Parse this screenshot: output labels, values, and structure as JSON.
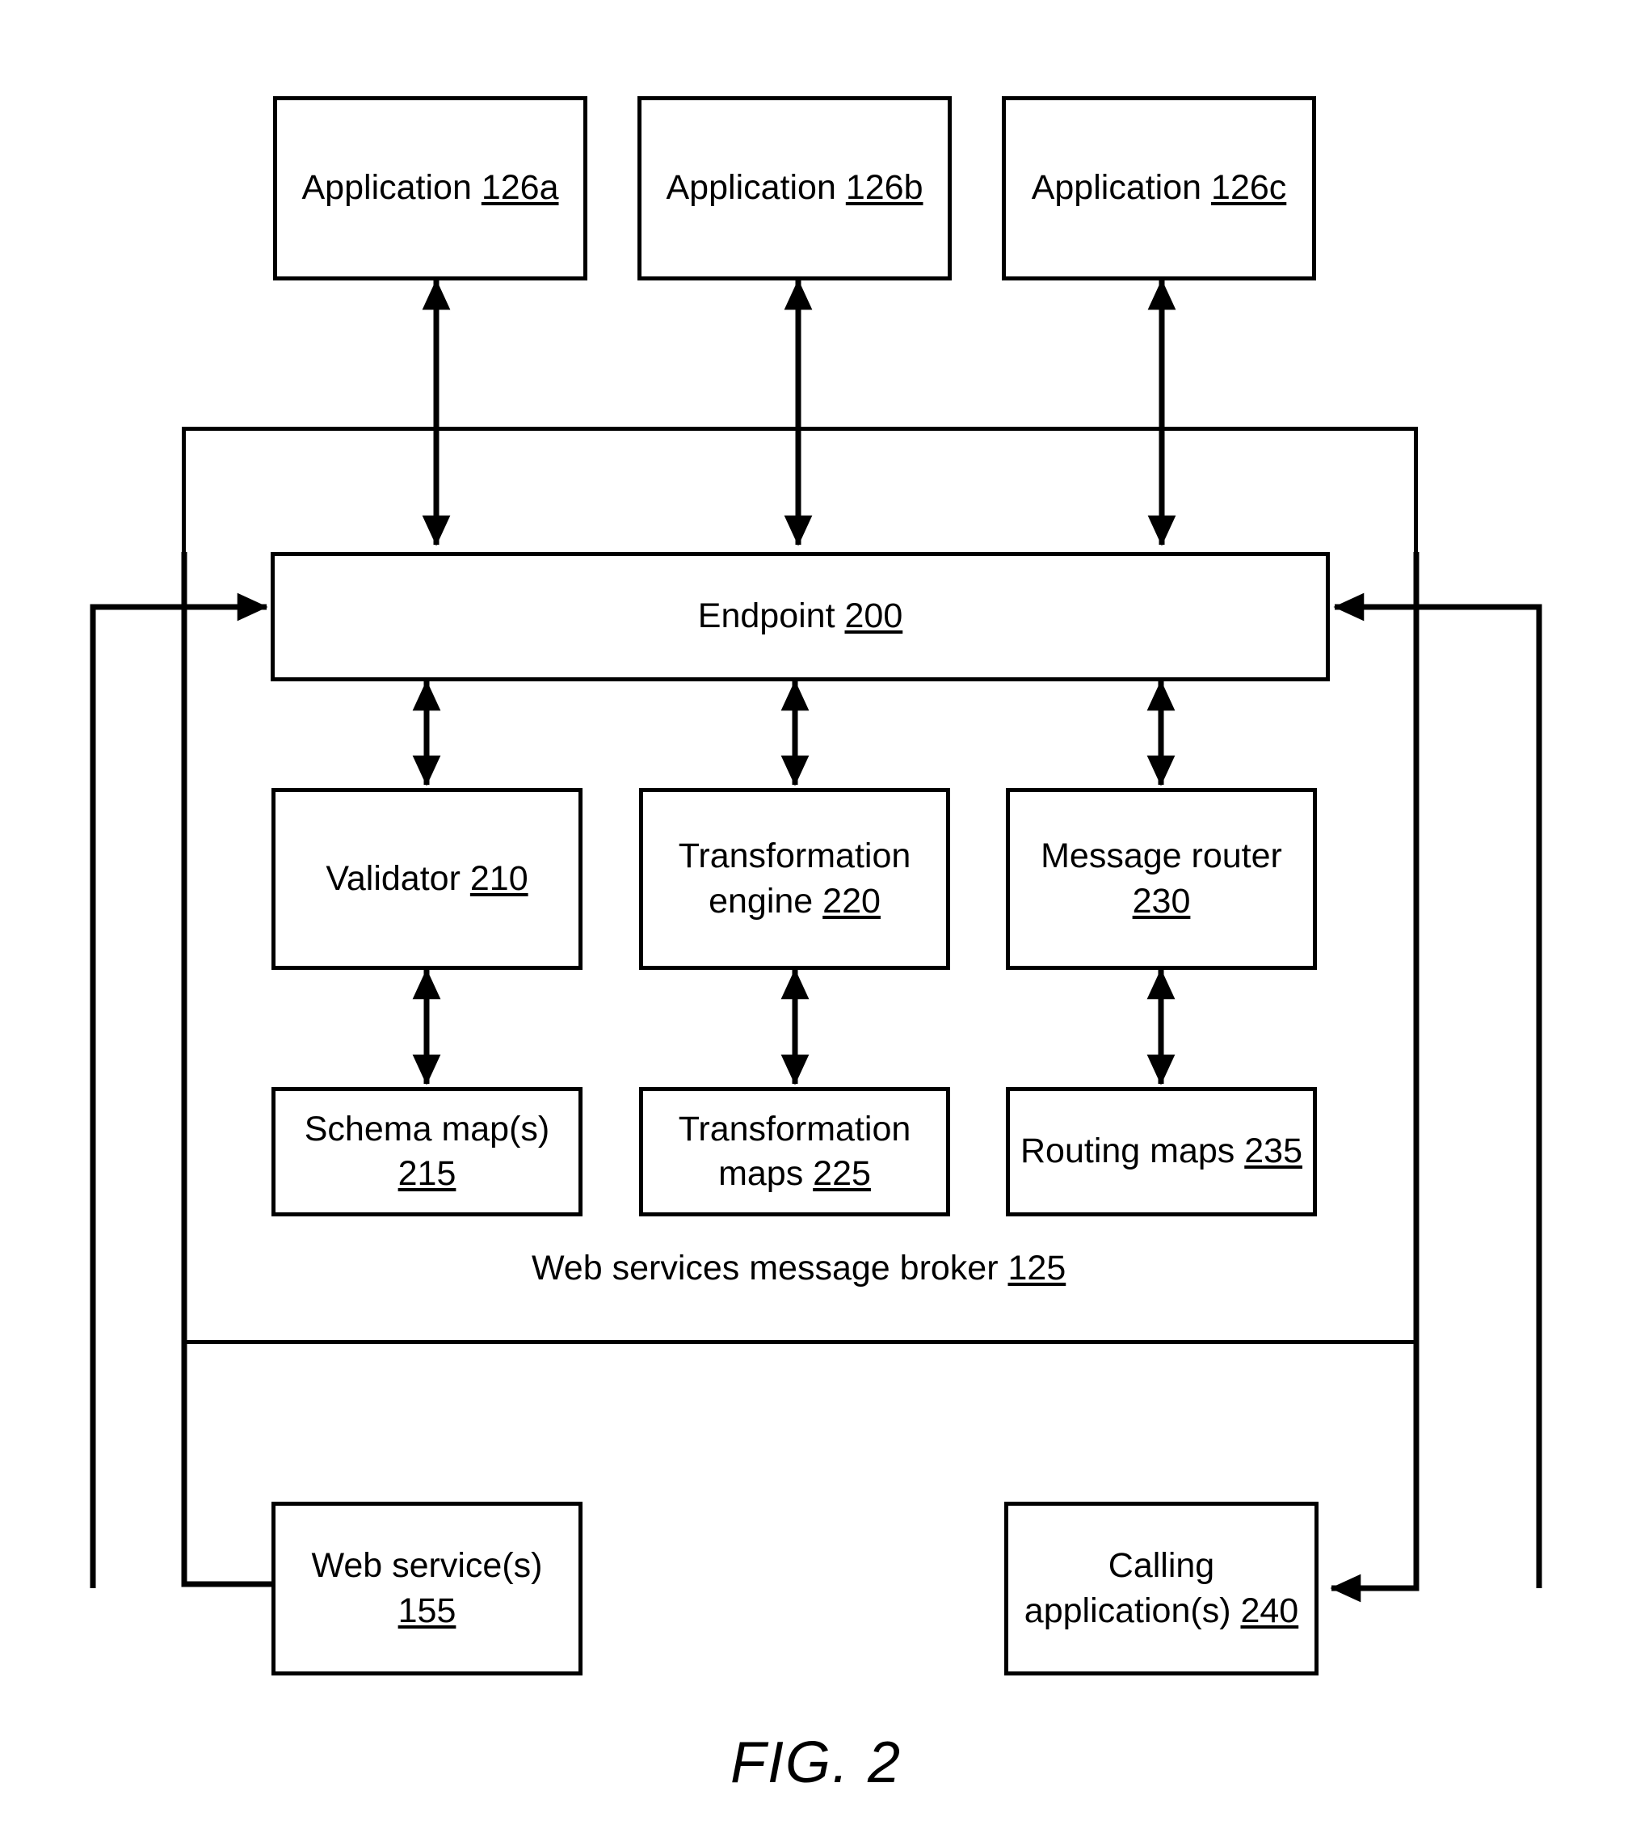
{
  "figure": {
    "caption": "FIG. 2",
    "ink_color": "#000000",
    "background_color": "#ffffff"
  },
  "nodes": {
    "application_a": {
      "name": "Application",
      "ref": "126a"
    },
    "application_b": {
      "name": "Application",
      "ref": "126b"
    },
    "application_c": {
      "name": "Application",
      "ref": "126c"
    },
    "endpoint": {
      "name": "Endpoint",
      "ref": "200"
    },
    "validator": {
      "name": "Validator",
      "ref": "210"
    },
    "transformation_engine": {
      "name": "Transformation engine",
      "ref": "220"
    },
    "message_router": {
      "name": "Message router",
      "ref": "230"
    },
    "schema_maps": {
      "name": "Schema map(s)",
      "ref": "215"
    },
    "transformation_maps": {
      "name": "Transformation maps",
      "ref": "225"
    },
    "routing_maps": {
      "name": "Routing maps",
      "ref": "235"
    },
    "web_services": {
      "name": "Web service(s)",
      "ref": "155"
    },
    "calling_applications": {
      "name": "Calling application(s)",
      "ref": "240"
    }
  },
  "groups": {
    "message_broker": {
      "name": "Web services message broker",
      "ref": "125"
    }
  },
  "connectors": [
    {
      "id": "app-a-endpoint",
      "from": "application_a",
      "to": "endpoint",
      "arrow": "double"
    },
    {
      "id": "app-b-endpoint",
      "from": "application_b",
      "to": "endpoint",
      "arrow": "double"
    },
    {
      "id": "app-c-endpoint",
      "from": "application_c",
      "to": "endpoint",
      "arrow": "double"
    },
    {
      "id": "endpoint-validator",
      "from": "endpoint",
      "to": "validator",
      "arrow": "double"
    },
    {
      "id": "endpoint-transformation-engine",
      "from": "endpoint",
      "to": "transformation_engine",
      "arrow": "double"
    },
    {
      "id": "endpoint-message-router",
      "from": "endpoint",
      "to": "message_router",
      "arrow": "double"
    },
    {
      "id": "validator-schema-maps",
      "from": "validator",
      "to": "schema_maps",
      "arrow": "double"
    },
    {
      "id": "transformation-engine-transformation-maps",
      "from": "transformation_engine",
      "to": "transformation_maps",
      "arrow": "double"
    },
    {
      "id": "message-router-routing-maps",
      "from": "message_router",
      "to": "routing_maps",
      "arrow": "double"
    },
    {
      "id": "web-services-endpoint",
      "from": "web_services",
      "to": "endpoint",
      "arrow": "single"
    },
    {
      "id": "endpoint-web-services",
      "from": "endpoint",
      "to": "web_services",
      "arrow": "single"
    },
    {
      "id": "calling-applications-endpoint",
      "from": "calling_applications",
      "to": "endpoint",
      "arrow": "single"
    },
    {
      "id": "endpoint-calling-applications",
      "from": "endpoint",
      "to": "calling_applications",
      "arrow": "single"
    }
  ]
}
